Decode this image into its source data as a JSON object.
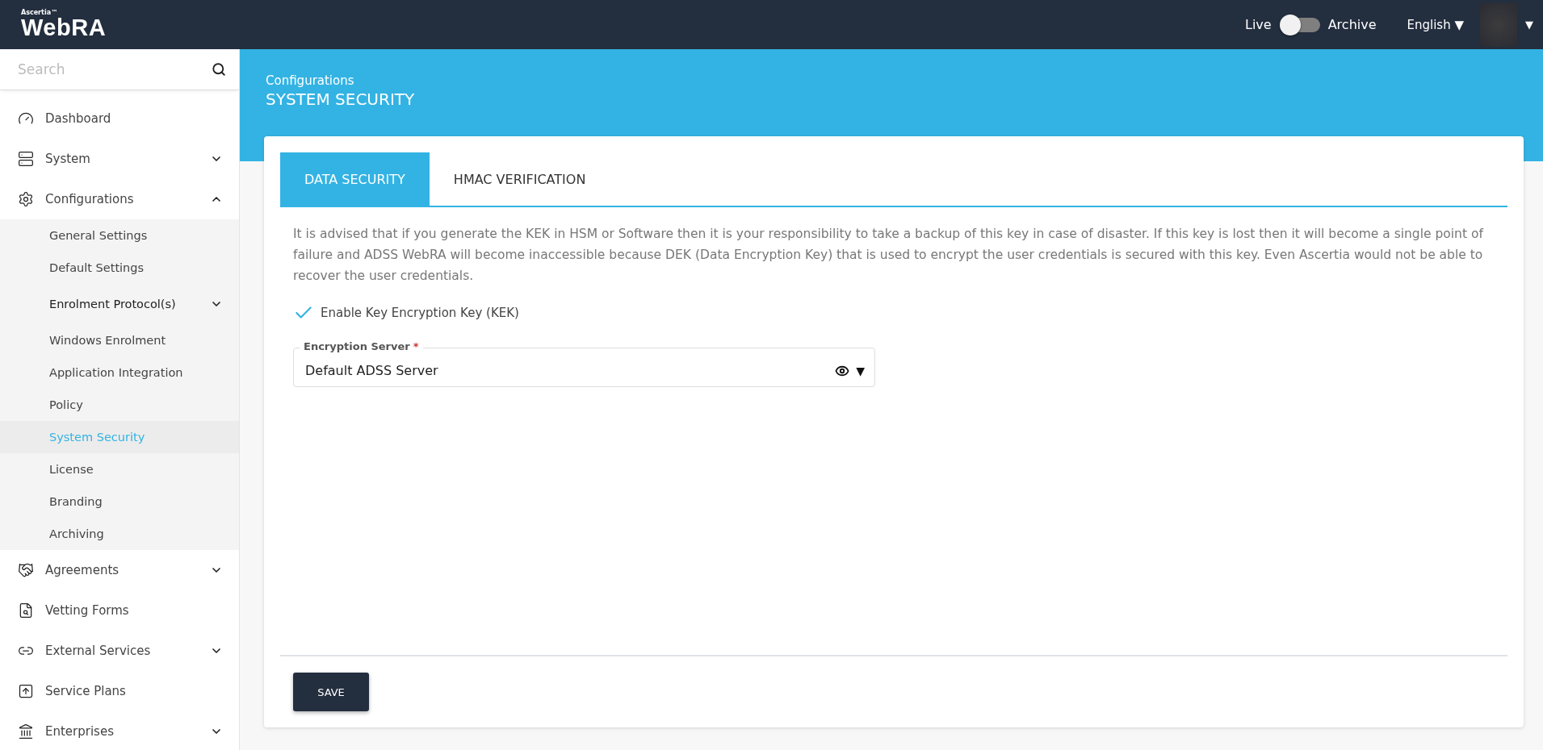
{
  "header": {
    "brand_small": "Ascertia™",
    "brand": "WebRA",
    "toggle": {
      "left_label": "Live",
      "right_label": "Archive",
      "on": false
    },
    "language": "English ▼",
    "user_caret": "▼"
  },
  "sidebar": {
    "search": {
      "placeholder": "Search"
    },
    "items": [
      {
        "label": "Dashboard"
      },
      {
        "label": "System",
        "expanded": false
      },
      {
        "label": "Configurations",
        "expanded": true,
        "children": [
          {
            "label": "General Settings",
            "selected": false
          },
          {
            "label": "Default Settings",
            "selected": false
          },
          {
            "label": "Enrolment Protocol(s)",
            "selected": false,
            "kind": "group",
            "expanded": false
          },
          {
            "label": "Windows Enrolment",
            "selected": false
          },
          {
            "label": "Application Integration",
            "selected": false
          },
          {
            "label": "Policy",
            "selected": false
          },
          {
            "label": "System Security",
            "selected": true
          },
          {
            "label": "License",
            "selected": false
          },
          {
            "label": "Branding",
            "selected": false
          },
          {
            "label": "Archiving",
            "selected": false
          }
        ]
      },
      {
        "label": "Agreements",
        "expanded": false
      },
      {
        "label": "Vetting Forms"
      },
      {
        "label": "External Services",
        "expanded": false
      },
      {
        "label": "Service Plans"
      },
      {
        "label": "Enterprises",
        "expanded": false
      }
    ]
  },
  "page": {
    "breadcrumb": "Configurations",
    "title": "SYSTEM SECURITY"
  },
  "tabs": [
    {
      "label": "DATA SECURITY",
      "selected": true
    },
    {
      "label": "HMAC VERIFICATION",
      "selected": false
    }
  ],
  "notice": "It is advised that if you generate the KEK in HSM or Software then it is your responsibility to take a backup of this key in case of disaster. If this key is lost then it will become a single point of failure and ADSS WebRA will become inaccessible because DEK (Data Encryption Key) that is used to encrypt the user credentials is secured with this key. Even Ascertia would not be able to recover the user credentials.",
  "kek_checkbox": {
    "label": "Enable Key Encryption Key (KEK)",
    "checked": true
  },
  "encryption_server": {
    "label": "Encryption Server",
    "required_mark": "*",
    "value": "Default ADSS Server",
    "caret": "▼"
  },
  "save_button": "SAVE"
}
